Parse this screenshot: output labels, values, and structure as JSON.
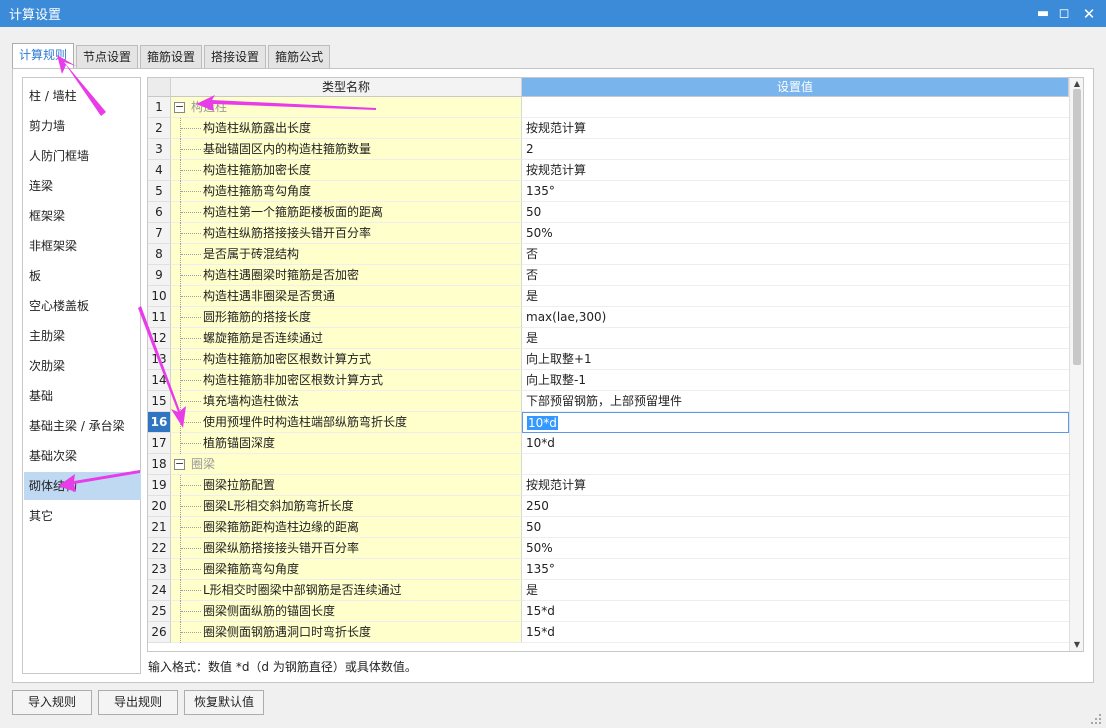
{
  "window": {
    "title": "计算设置",
    "min_symbol": "▬",
    "max_symbol": "◻",
    "close_symbol": "✕"
  },
  "tabs": [
    {
      "label": "计算规则"
    },
    {
      "label": "节点设置"
    },
    {
      "label": "箍筋设置"
    },
    {
      "label": "搭接设置"
    },
    {
      "label": "箍筋公式"
    }
  ],
  "nav": [
    {
      "label": "柱 / 墙柱"
    },
    {
      "label": "剪力墙"
    },
    {
      "label": "人防门框墙"
    },
    {
      "label": "连梁"
    },
    {
      "label": "框架梁"
    },
    {
      "label": "非框架梁"
    },
    {
      "label": "板"
    },
    {
      "label": "空心楼盖板"
    },
    {
      "label": "主肋梁"
    },
    {
      "label": "次肋梁"
    },
    {
      "label": "基础"
    },
    {
      "label": "基础主梁 / 承台梁"
    },
    {
      "label": "基础次梁"
    },
    {
      "label": "砌体结构"
    },
    {
      "label": "其它"
    }
  ],
  "grid": {
    "headers": {
      "num": "",
      "name": "类型名称",
      "value": "设置值"
    },
    "rows": [
      {
        "num": "1",
        "name": "构造柱",
        "value": "",
        "group": true,
        "toggle": "−"
      },
      {
        "num": "2",
        "name": "构造柱纵筋露出长度",
        "value": "按规范计算"
      },
      {
        "num": "3",
        "name": "基础锚固区内的构造柱箍筋数量",
        "value": "2"
      },
      {
        "num": "4",
        "name": "构造柱箍筋加密长度",
        "value": "按规范计算"
      },
      {
        "num": "5",
        "name": "构造柱箍筋弯勾角度",
        "value": "135°"
      },
      {
        "num": "6",
        "name": "构造柱第一个箍筋距楼板面的距离",
        "value": "50"
      },
      {
        "num": "7",
        "name": "构造柱纵筋搭接接头错开百分率",
        "value": "50%"
      },
      {
        "num": "8",
        "name": "是否属于砖混结构",
        "value": "否"
      },
      {
        "num": "9",
        "name": "构造柱遇圈梁时箍筋是否加密",
        "value": "否"
      },
      {
        "num": "10",
        "name": "构造柱遇非圈梁是否贯通",
        "value": "是"
      },
      {
        "num": "11",
        "name": "圆形箍筋的搭接长度",
        "value": "max(lae,300)"
      },
      {
        "num": "12",
        "name": "螺旋箍筋是否连续通过",
        "value": "是"
      },
      {
        "num": "13",
        "name": "构造柱箍筋加密区根数计算方式",
        "value": "向上取整+1"
      },
      {
        "num": "14",
        "name": "构造柱箍筋非加密区根数计算方式",
        "value": "向上取整-1"
      },
      {
        "num": "15",
        "name": "填充墙构造柱做法",
        "value": "下部预留钢筋，上部预留埋件"
      },
      {
        "num": "16",
        "name": "使用预埋件时构造柱端部纵筋弯折长度",
        "value": "10*d",
        "selected": true
      },
      {
        "num": "17",
        "name": "植筋锚固深度",
        "value": "10*d"
      },
      {
        "num": "18",
        "name": "圈梁",
        "value": "",
        "group": true,
        "toggle": "−"
      },
      {
        "num": "19",
        "name": "圈梁拉筋配置",
        "value": "按规范计算"
      },
      {
        "num": "20",
        "name": "圈梁L形相交斜加筋弯折长度",
        "value": "250"
      },
      {
        "num": "21",
        "name": "圈梁箍筋距构造柱边缘的距离",
        "value": "50"
      },
      {
        "num": "22",
        "name": "圈梁纵筋搭接接头错开百分率",
        "value": "50%"
      },
      {
        "num": "23",
        "name": "圈梁箍筋弯勾角度",
        "value": "135°"
      },
      {
        "num": "24",
        "name": "L形相交时圈梁中部钢筋是否连续通过",
        "value": "是"
      },
      {
        "num": "25",
        "name": "圈梁侧面纵筋的锚固长度",
        "value": "15*d"
      },
      {
        "num": "26",
        "name": "圈梁侧面钢筋遇洞口时弯折长度",
        "value": "15*d"
      }
    ]
  },
  "hint": "输入格式：数值 *d（d 为钢筋直径）或具体数值。",
  "buttons": {
    "import": "导入规则",
    "export": "导出规则",
    "restore": "恢复默认值"
  },
  "colors": {
    "titlebar": "#3c8bd9",
    "accent": "#2d7bd2",
    "annotation_arrow": "#e83ce8",
    "row_name_bg": "#ffffcc"
  }
}
